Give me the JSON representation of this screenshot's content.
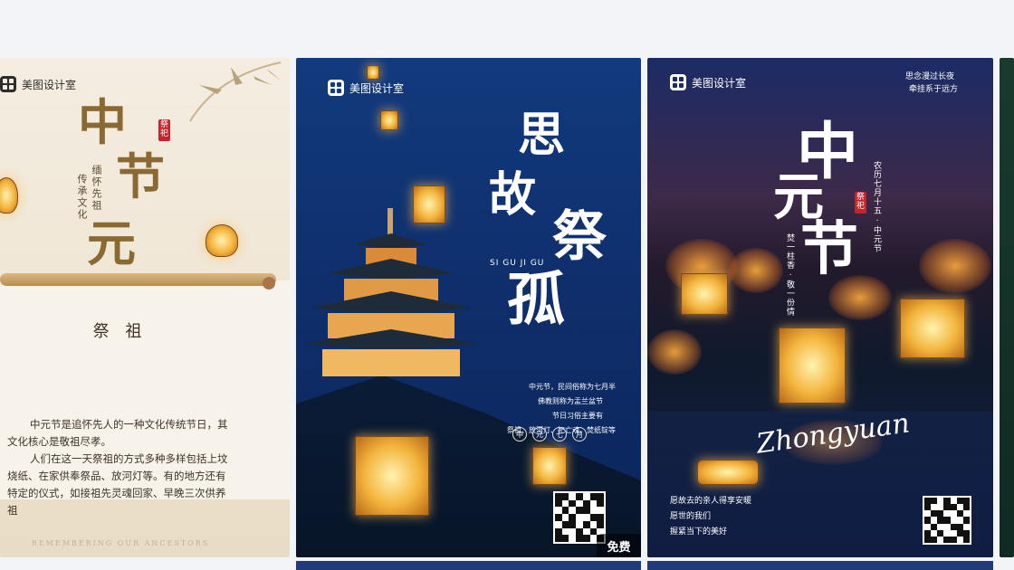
{
  "card1": {
    "brand": "美图设计室",
    "title_chars": [
      "中",
      "节",
      "元"
    ],
    "seal": "祭祀",
    "vertical_lines": [
      "缅怀先祖",
      "传承文化"
    ],
    "subtitle": "祭 祖",
    "paragraphs": [
      "中元节是追怀先人的一种文化传统节日，其文化核心是敬祖尽孝。",
      "人们在这一天祭祖的方式多种多样包括上坟烧纸、在家供奉祭品、放河灯等。有的地方还有特定的仪式，如接祖先灵魂回家、早晚三次供养祖"
    ],
    "footer": "REMEMBERING OUR ANCESTORS"
  },
  "card2": {
    "brand": "美图设计室",
    "big_chars": [
      "思",
      "故",
      "祭",
      "孤"
    ],
    "pinyin": "SI GU JI GU",
    "text_lines": [
      "中元节，民间俗称为七月半",
      "佛教则称为盂兰盆节",
      "节日习俗主要有",
      "祭祖、放河灯、祀亡魂、焚纸锭等"
    ],
    "tags": [
      "中",
      "元",
      "七",
      "月"
    ],
    "badge": "免费"
  },
  "card3": {
    "brand": "美图设计室",
    "top_right": [
      "思念漫过长夜",
      "牵挂系于远方"
    ],
    "big_chars": [
      "中",
      "元",
      "节"
    ],
    "seal": "祭祀",
    "vertical_right": "农历七月十五 · 中元节",
    "vertical_left": "焚一柱香 · 敬一份情",
    "script": "Zhongyuan",
    "bottom_lines": [
      "愿故去的亲人得享安暖",
      "愿世的我们",
      "握紧当下的美好"
    ]
  },
  "colors": {
    "card1_title": "#8a6a32",
    "card2_bg": "#123a7e",
    "seal_red": "#c2262a",
    "lantern": "#f3b33b"
  }
}
